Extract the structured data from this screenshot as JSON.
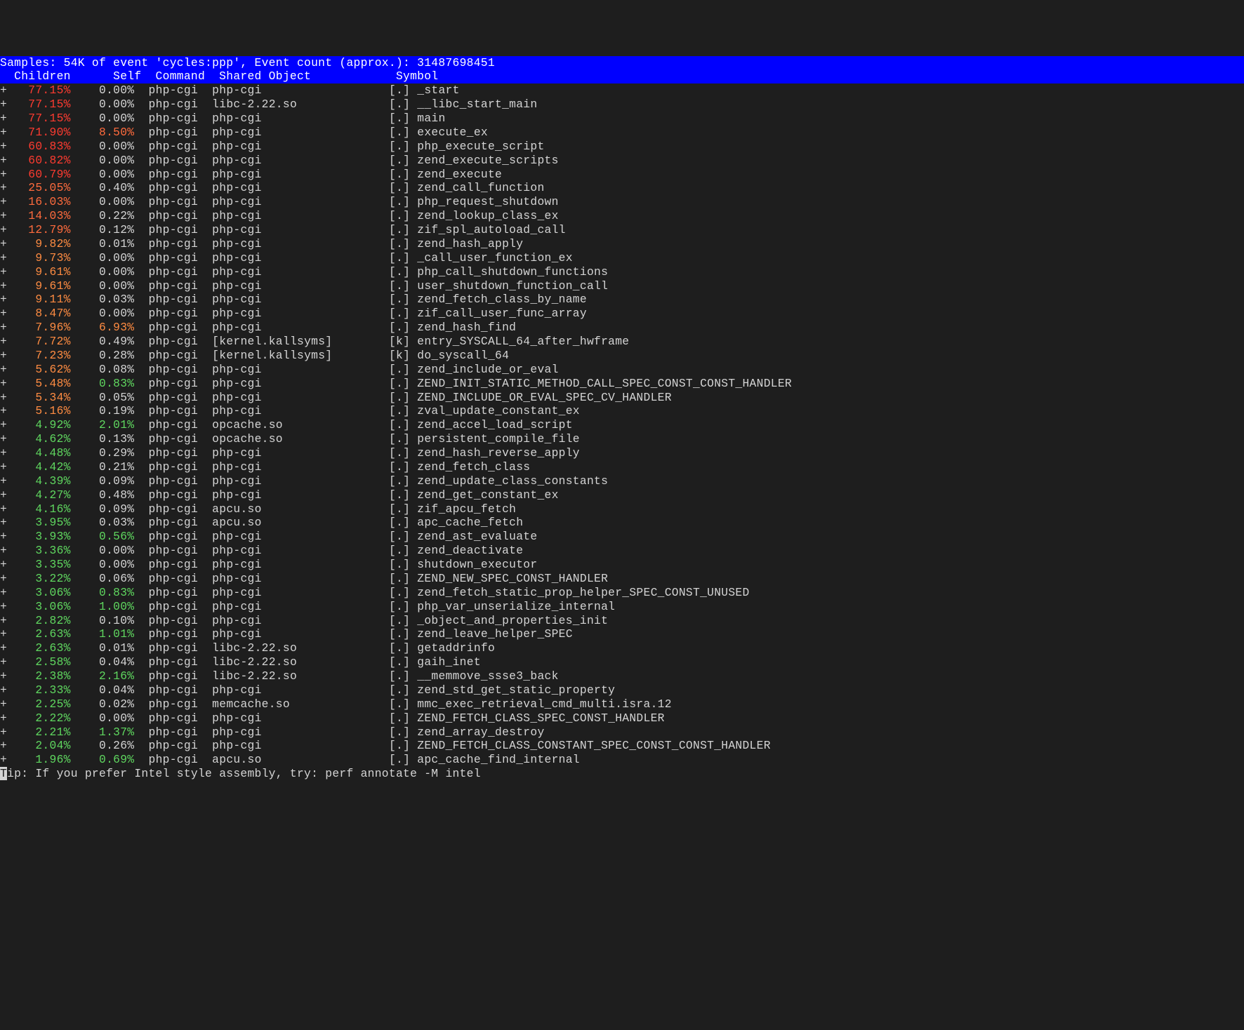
{
  "header": "Samples: 54K of event 'cycles:ppp', Event count (approx.): 31487698451",
  "columns": "  Children      Self  Command  Shared Object            Symbol",
  "footer_prefix": "T",
  "footer": "ip: If you prefer Intel style assembly, try: perf annotate -M intel",
  "rows": [
    {
      "children": "77.15%",
      "self": "0.00%",
      "cmd": "php-cgi",
      "obj": "php-cgi",
      "tag": "[.]",
      "sym": "_start",
      "ct": "tier1",
      "st": "white"
    },
    {
      "children": "77.15%",
      "self": "0.00%",
      "cmd": "php-cgi",
      "obj": "libc-2.22.so",
      "tag": "[.]",
      "sym": "__libc_start_main",
      "ct": "tier1",
      "st": "white"
    },
    {
      "children": "77.15%",
      "self": "0.00%",
      "cmd": "php-cgi",
      "obj": "php-cgi",
      "tag": "[.]",
      "sym": "main",
      "ct": "tier1",
      "st": "white"
    },
    {
      "children": "71.90%",
      "self": "8.50%",
      "cmd": "php-cgi",
      "obj": "php-cgi",
      "tag": "[.]",
      "sym": "execute_ex",
      "ct": "tier1",
      "st": "tier2"
    },
    {
      "children": "60.83%",
      "self": "0.00%",
      "cmd": "php-cgi",
      "obj": "php-cgi",
      "tag": "[.]",
      "sym": "php_execute_script",
      "ct": "tier1",
      "st": "white"
    },
    {
      "children": "60.82%",
      "self": "0.00%",
      "cmd": "php-cgi",
      "obj": "php-cgi",
      "tag": "[.]",
      "sym": "zend_execute_scripts",
      "ct": "tier1",
      "st": "white"
    },
    {
      "children": "60.79%",
      "self": "0.00%",
      "cmd": "php-cgi",
      "obj": "php-cgi",
      "tag": "[.]",
      "sym": "zend_execute",
      "ct": "tier1",
      "st": "white"
    },
    {
      "children": "25.05%",
      "self": "0.40%",
      "cmd": "php-cgi",
      "obj": "php-cgi",
      "tag": "[.]",
      "sym": "zend_call_function",
      "ct": "tier2",
      "st": "white"
    },
    {
      "children": "16.03%",
      "self": "0.00%",
      "cmd": "php-cgi",
      "obj": "php-cgi",
      "tag": "[.]",
      "sym": "php_request_shutdown",
      "ct": "tier2",
      "st": "white"
    },
    {
      "children": "14.03%",
      "self": "0.22%",
      "cmd": "php-cgi",
      "obj": "php-cgi",
      "tag": "[.]",
      "sym": "zend_lookup_class_ex",
      "ct": "tier2",
      "st": "white"
    },
    {
      "children": "12.79%",
      "self": "0.12%",
      "cmd": "php-cgi",
      "obj": "php-cgi",
      "tag": "[.]",
      "sym": "zif_spl_autoload_call",
      "ct": "tier2",
      "st": "white"
    },
    {
      "children": "9.82%",
      "self": "0.01%",
      "cmd": "php-cgi",
      "obj": "php-cgi",
      "tag": "[.]",
      "sym": "zend_hash_apply",
      "ct": "tier3",
      "st": "white"
    },
    {
      "children": "9.73%",
      "self": "0.00%",
      "cmd": "php-cgi",
      "obj": "php-cgi",
      "tag": "[.]",
      "sym": "_call_user_function_ex",
      "ct": "tier3",
      "st": "white"
    },
    {
      "children": "9.61%",
      "self": "0.00%",
      "cmd": "php-cgi",
      "obj": "php-cgi",
      "tag": "[.]",
      "sym": "php_call_shutdown_functions",
      "ct": "tier3",
      "st": "white"
    },
    {
      "children": "9.61%",
      "self": "0.00%",
      "cmd": "php-cgi",
      "obj": "php-cgi",
      "tag": "[.]",
      "sym": "user_shutdown_function_call",
      "ct": "tier3",
      "st": "white"
    },
    {
      "children": "9.11%",
      "self": "0.03%",
      "cmd": "php-cgi",
      "obj": "php-cgi",
      "tag": "[.]",
      "sym": "zend_fetch_class_by_name",
      "ct": "tier3",
      "st": "white"
    },
    {
      "children": "8.47%",
      "self": "0.00%",
      "cmd": "php-cgi",
      "obj": "php-cgi",
      "tag": "[.]",
      "sym": "zif_call_user_func_array",
      "ct": "tier3",
      "st": "white"
    },
    {
      "children": "7.96%",
      "self": "6.93%",
      "cmd": "php-cgi",
      "obj": "php-cgi",
      "tag": "[.]",
      "sym": "zend_hash_find",
      "ct": "tier3",
      "st": "tier3"
    },
    {
      "children": "7.72%",
      "self": "0.49%",
      "cmd": "php-cgi",
      "obj": "[kernel.kallsyms]",
      "tag": "[k]",
      "sym": "entry_SYSCALL_64_after_hwframe",
      "ct": "tier3",
      "st": "white"
    },
    {
      "children": "7.23%",
      "self": "0.28%",
      "cmd": "php-cgi",
      "obj": "[kernel.kallsyms]",
      "tag": "[k]",
      "sym": "do_syscall_64",
      "ct": "tier3",
      "st": "white"
    },
    {
      "children": "5.62%",
      "self": "0.08%",
      "cmd": "php-cgi",
      "obj": "php-cgi",
      "tag": "[.]",
      "sym": "zend_include_or_eval",
      "ct": "tier3",
      "st": "white"
    },
    {
      "children": "5.48%",
      "self": "0.83%",
      "cmd": "php-cgi",
      "obj": "php-cgi",
      "tag": "[.]",
      "sym": "ZEND_INIT_STATIC_METHOD_CALL_SPEC_CONST_CONST_HANDLER",
      "ct": "tier3",
      "st": "tier4"
    },
    {
      "children": "5.34%",
      "self": "0.05%",
      "cmd": "php-cgi",
      "obj": "php-cgi",
      "tag": "[.]",
      "sym": "ZEND_INCLUDE_OR_EVAL_SPEC_CV_HANDLER",
      "ct": "tier3",
      "st": "white"
    },
    {
      "children": "5.16%",
      "self": "0.19%",
      "cmd": "php-cgi",
      "obj": "php-cgi",
      "tag": "[.]",
      "sym": "zval_update_constant_ex",
      "ct": "tier3",
      "st": "white"
    },
    {
      "children": "4.92%",
      "self": "2.01%",
      "cmd": "php-cgi",
      "obj": "opcache.so",
      "tag": "[.]",
      "sym": "zend_accel_load_script",
      "ct": "tier4",
      "st": "tier4"
    },
    {
      "children": "4.62%",
      "self": "0.13%",
      "cmd": "php-cgi",
      "obj": "opcache.so",
      "tag": "[.]",
      "sym": "persistent_compile_file",
      "ct": "tier4",
      "st": "white"
    },
    {
      "children": "4.48%",
      "self": "0.29%",
      "cmd": "php-cgi",
      "obj": "php-cgi",
      "tag": "[.]",
      "sym": "zend_hash_reverse_apply",
      "ct": "tier4",
      "st": "white"
    },
    {
      "children": "4.42%",
      "self": "0.21%",
      "cmd": "php-cgi",
      "obj": "php-cgi",
      "tag": "[.]",
      "sym": "zend_fetch_class",
      "ct": "tier4",
      "st": "white"
    },
    {
      "children": "4.39%",
      "self": "0.09%",
      "cmd": "php-cgi",
      "obj": "php-cgi",
      "tag": "[.]",
      "sym": "zend_update_class_constants",
      "ct": "tier4",
      "st": "white"
    },
    {
      "children": "4.27%",
      "self": "0.48%",
      "cmd": "php-cgi",
      "obj": "php-cgi",
      "tag": "[.]",
      "sym": "zend_get_constant_ex",
      "ct": "tier4",
      "st": "white"
    },
    {
      "children": "4.16%",
      "self": "0.09%",
      "cmd": "php-cgi",
      "obj": "apcu.so",
      "tag": "[.]",
      "sym": "zif_apcu_fetch",
      "ct": "tier4",
      "st": "white"
    },
    {
      "children": "3.95%",
      "self": "0.03%",
      "cmd": "php-cgi",
      "obj": "apcu.so",
      "tag": "[.]",
      "sym": "apc_cache_fetch",
      "ct": "tier4",
      "st": "white"
    },
    {
      "children": "3.93%",
      "self": "0.56%",
      "cmd": "php-cgi",
      "obj": "php-cgi",
      "tag": "[.]",
      "sym": "zend_ast_evaluate",
      "ct": "tier4",
      "st": "tier4"
    },
    {
      "children": "3.36%",
      "self": "0.00%",
      "cmd": "php-cgi",
      "obj": "php-cgi",
      "tag": "[.]",
      "sym": "zend_deactivate",
      "ct": "tier4",
      "st": "white"
    },
    {
      "children": "3.35%",
      "self": "0.00%",
      "cmd": "php-cgi",
      "obj": "php-cgi",
      "tag": "[.]",
      "sym": "shutdown_executor",
      "ct": "tier4",
      "st": "white"
    },
    {
      "children": "3.22%",
      "self": "0.06%",
      "cmd": "php-cgi",
      "obj": "php-cgi",
      "tag": "[.]",
      "sym": "ZEND_NEW_SPEC_CONST_HANDLER",
      "ct": "tier4",
      "st": "white"
    },
    {
      "children": "3.06%",
      "self": "0.83%",
      "cmd": "php-cgi",
      "obj": "php-cgi",
      "tag": "[.]",
      "sym": "zend_fetch_static_prop_helper_SPEC_CONST_UNUSED",
      "ct": "tier4",
      "st": "tier4"
    },
    {
      "children": "3.06%",
      "self": "1.00%",
      "cmd": "php-cgi",
      "obj": "php-cgi",
      "tag": "[.]",
      "sym": "php_var_unserialize_internal",
      "ct": "tier4",
      "st": "tier4"
    },
    {
      "children": "2.82%",
      "self": "0.10%",
      "cmd": "php-cgi",
      "obj": "php-cgi",
      "tag": "[.]",
      "sym": "_object_and_properties_init",
      "ct": "tier4",
      "st": "white"
    },
    {
      "children": "2.63%",
      "self": "1.01%",
      "cmd": "php-cgi",
      "obj": "php-cgi",
      "tag": "[.]",
      "sym": "zend_leave_helper_SPEC",
      "ct": "tier4",
      "st": "tier4"
    },
    {
      "children": "2.63%",
      "self": "0.01%",
      "cmd": "php-cgi",
      "obj": "libc-2.22.so",
      "tag": "[.]",
      "sym": "getaddrinfo",
      "ct": "tier4",
      "st": "white"
    },
    {
      "children": "2.58%",
      "self": "0.04%",
      "cmd": "php-cgi",
      "obj": "libc-2.22.so",
      "tag": "[.]",
      "sym": "gaih_inet",
      "ct": "tier4",
      "st": "white"
    },
    {
      "children": "2.38%",
      "self": "2.16%",
      "cmd": "php-cgi",
      "obj": "libc-2.22.so",
      "tag": "[.]",
      "sym": "__memmove_ssse3_back",
      "ct": "tier4",
      "st": "tier4"
    },
    {
      "children": "2.33%",
      "self": "0.04%",
      "cmd": "php-cgi",
      "obj": "php-cgi",
      "tag": "[.]",
      "sym": "zend_std_get_static_property",
      "ct": "tier4",
      "st": "white"
    },
    {
      "children": "2.25%",
      "self": "0.02%",
      "cmd": "php-cgi",
      "obj": "memcache.so",
      "tag": "[.]",
      "sym": "mmc_exec_retrieval_cmd_multi.isra.12",
      "ct": "tier4",
      "st": "white"
    },
    {
      "children": "2.22%",
      "self": "0.00%",
      "cmd": "php-cgi",
      "obj": "php-cgi",
      "tag": "[.]",
      "sym": "ZEND_FETCH_CLASS_SPEC_CONST_HANDLER",
      "ct": "tier4",
      "st": "white"
    },
    {
      "children": "2.21%",
      "self": "1.37%",
      "cmd": "php-cgi",
      "obj": "php-cgi",
      "tag": "[.]",
      "sym": "zend_array_destroy",
      "ct": "tier4",
      "st": "tier4"
    },
    {
      "children": "2.04%",
      "self": "0.26%",
      "cmd": "php-cgi",
      "obj": "php-cgi",
      "tag": "[.]",
      "sym": "ZEND_FETCH_CLASS_CONSTANT_SPEC_CONST_CONST_HANDLER",
      "ct": "tier4",
      "st": "white"
    },
    {
      "children": "1.96%",
      "self": "0.69%",
      "cmd": "php-cgi",
      "obj": "apcu.so",
      "tag": "[.]",
      "sym": "apc_cache_find_internal",
      "ct": "tier4",
      "st": "tier4"
    }
  ]
}
